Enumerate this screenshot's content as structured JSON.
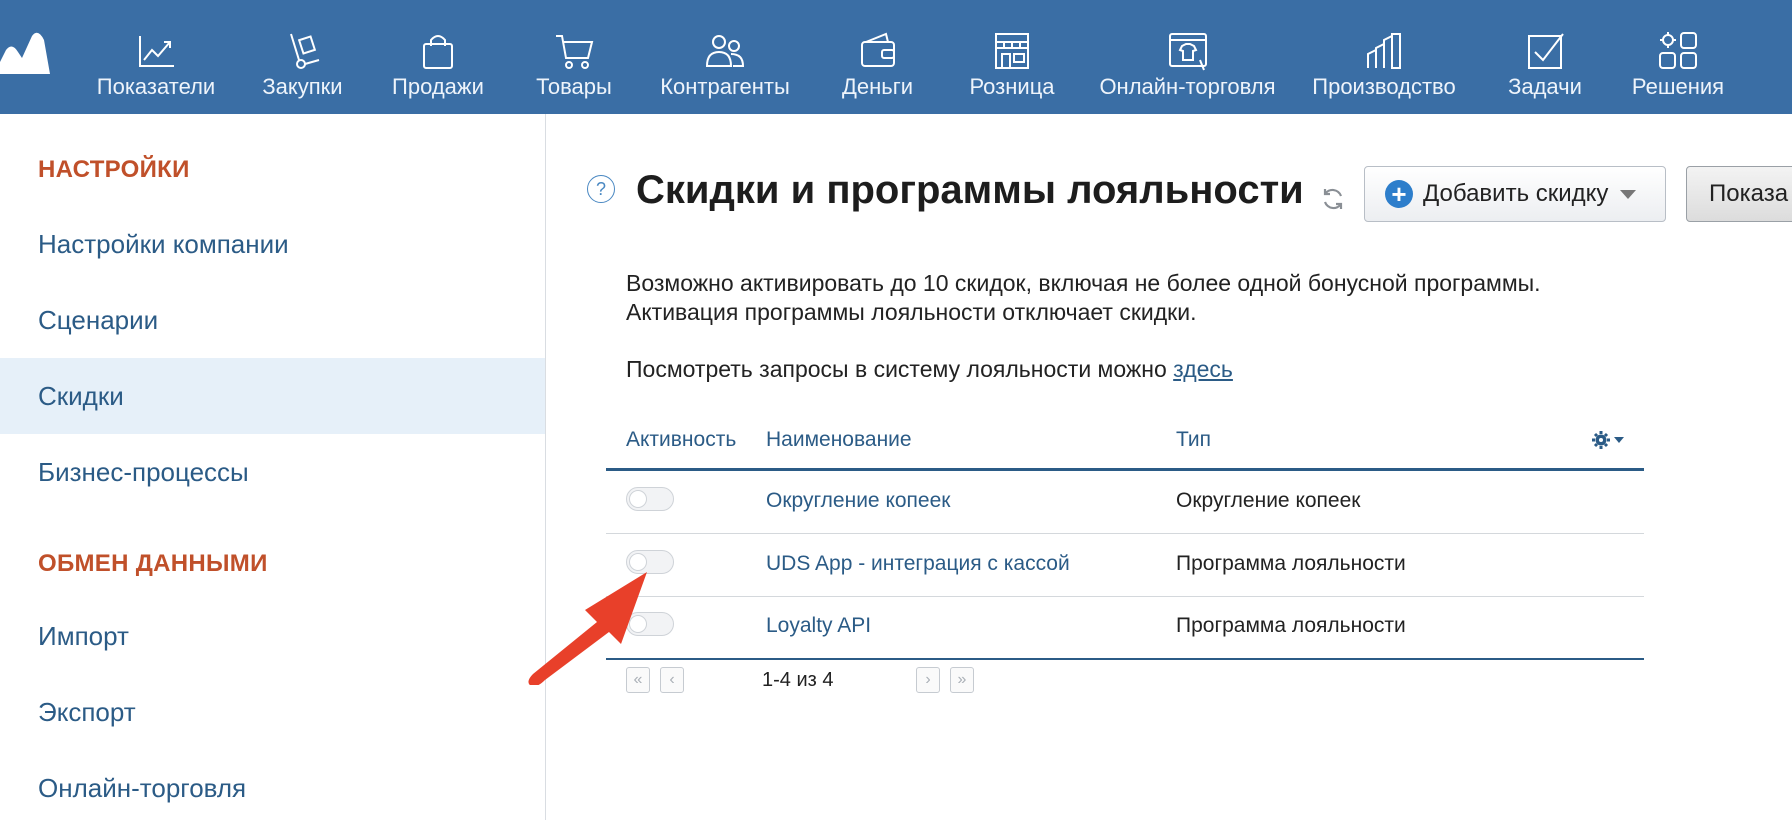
{
  "nav": {
    "items": [
      {
        "label": "Показатели",
        "icon": "chart-line-icon"
      },
      {
        "label": "Закупки",
        "icon": "hand-truck-icon"
      },
      {
        "label": "Продажи",
        "icon": "shopping-bag-icon"
      },
      {
        "label": "Товары",
        "icon": "shopping-cart-icon"
      },
      {
        "label": "Контрагенты",
        "icon": "users-icon"
      },
      {
        "label": "Деньги",
        "icon": "wallet-icon"
      },
      {
        "label": "Розница",
        "icon": "storefront-icon"
      },
      {
        "label": "Онлайн-торговля",
        "icon": "online-store-icon"
      },
      {
        "label": "Производство",
        "icon": "factory-icon"
      },
      {
        "label": "Задачи",
        "icon": "checkbox-icon"
      },
      {
        "label": "Решения",
        "icon": "apps-grid-icon"
      }
    ]
  },
  "sidebar": {
    "section1": "НАСТРОЙКИ",
    "items1": [
      "Настройки компании",
      "Сценарии",
      "Скидки",
      "Бизнес-процессы"
    ],
    "section2": "ОБМЕН ДАННЫМИ",
    "items2": [
      "Импорт",
      "Экспорт",
      "Онлайн-торговля"
    ],
    "active": "Скидки"
  },
  "main": {
    "title": "Скидки и программы лояльности",
    "add_button": "Добавить скидку",
    "show_button": "Показа",
    "info_line1": "Возможно активировать до 10 скидок, включая не более одной бонусной программы.",
    "info_line2": "Активация программы лояльности отключает скидки.",
    "requests_text": "Посмотреть запросы в систему лояльности можно",
    "requests_link": "здесь",
    "table": {
      "headers": {
        "activity": "Активность",
        "name": "Наименование",
        "type": "Тип"
      },
      "rows": [
        {
          "name": "Округление копеек",
          "type": "Округление копеек",
          "active": false
        },
        {
          "name": "UDS App - интеграция с кассой",
          "type": "Программа лояльности",
          "active": false
        },
        {
          "name": "Loyalty API",
          "type": "Программа лояльности",
          "active": false
        }
      ]
    },
    "pager": {
      "label": "1-4 из 4",
      "first": "«",
      "prev": "‹",
      "next": "›",
      "last": "»"
    }
  },
  "colors": {
    "nav_bg": "#3a6ea5",
    "link": "#2b5b86",
    "section_heading": "#c0502a",
    "active_item_bg": "#e6f0f9",
    "accent_arrow": "#e8402a",
    "add_icon": "#2d7ecb"
  }
}
